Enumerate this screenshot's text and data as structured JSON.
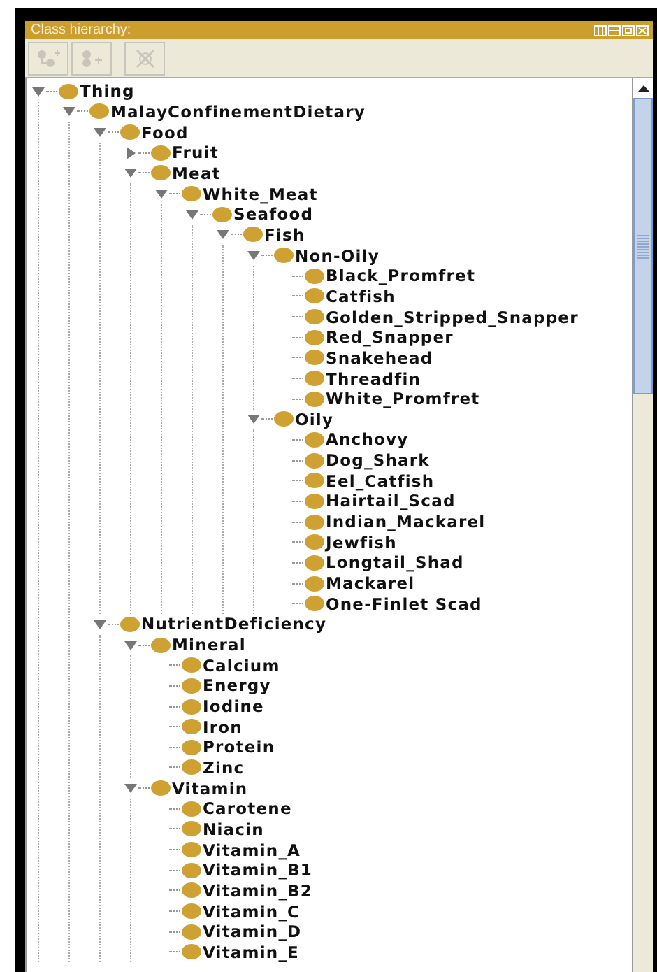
{
  "panel": {
    "title": "Class hierarchy:"
  },
  "tree": [
    {
      "label": "Thing",
      "expanded": true,
      "children": [
        {
          "label": "MalayConfinementDietary",
          "expanded": true,
          "children": [
            {
              "label": "Food",
              "expanded": true,
              "children": [
                {
                  "label": "Fruit",
                  "expanded": false
                },
                {
                  "label": "Meat",
                  "expanded": true,
                  "children": [
                    {
                      "label": "White_Meat",
                      "expanded": true,
                      "children": [
                        {
                          "label": "Seafood",
                          "expanded": true,
                          "children": [
                            {
                              "label": "Fish",
                              "expanded": true,
                              "children": [
                                {
                                  "label": "Non-Oily",
                                  "expanded": true,
                                  "children": [
                                    {
                                      "label": "Black_Promfret"
                                    },
                                    {
                                      "label": "Catfish"
                                    },
                                    {
                                      "label": "Golden_Stripped_Snapper"
                                    },
                                    {
                                      "label": "Red_Snapper"
                                    },
                                    {
                                      "label": "Snakehead"
                                    },
                                    {
                                      "label": "Threadfin"
                                    },
                                    {
                                      "label": "White_Promfret"
                                    }
                                  ]
                                },
                                {
                                  "label": "Oily",
                                  "expanded": true,
                                  "children": [
                                    {
                                      "label": "Anchovy"
                                    },
                                    {
                                      "label": "Dog_Shark"
                                    },
                                    {
                                      "label": "Eel_Catfish"
                                    },
                                    {
                                      "label": "Hairtail_Scad"
                                    },
                                    {
                                      "label": "Indian_Mackarel"
                                    },
                                    {
                                      "label": "Jewfish"
                                    },
                                    {
                                      "label": "Longtail_Shad"
                                    },
                                    {
                                      "label": "Mackarel"
                                    },
                                    {
                                      "label": "One-Finlet  Scad"
                                    }
                                  ]
                                }
                              ]
                            }
                          ]
                        }
                      ]
                    }
                  ]
                }
              ]
            },
            {
              "label": "NutrientDeficiency",
              "expanded": true,
              "children": [
                {
                  "label": "Mineral",
                  "expanded": true,
                  "children": [
                    {
                      "label": "Calcium"
                    },
                    {
                      "label": "Energy"
                    },
                    {
                      "label": "Iodine"
                    },
                    {
                      "label": "Iron"
                    },
                    {
                      "label": "Protein"
                    },
                    {
                      "label": "Zinc"
                    }
                  ]
                },
                {
                  "label": "Vitamin",
                  "expanded": true,
                  "children": [
                    {
                      "label": "Carotene"
                    },
                    {
                      "label": "Niacin"
                    },
                    {
                      "label": "Vitamin_A"
                    },
                    {
                      "label": "Vitamin_B1"
                    },
                    {
                      "label": "Vitamin_B2"
                    },
                    {
                      "label": "Vitamin_C"
                    },
                    {
                      "label": "Vitamin_D"
                    },
                    {
                      "label": "Vitamin_E"
                    }
                  ]
                }
              ]
            }
          ]
        }
      ]
    }
  ]
}
